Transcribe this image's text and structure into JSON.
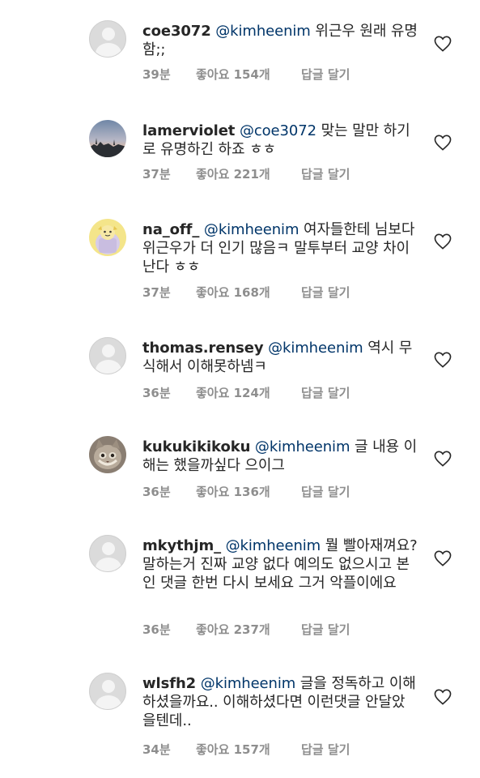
{
  "comments": [
    {
      "username": "coe3072",
      "mention": "@kimheenim",
      "text": "위근우 원래 유명함;;",
      "time": "39분",
      "likes": "좋아요 154개",
      "reply": "답글 달기",
      "avatar_icon": "default-avatar-icon"
    },
    {
      "username": "lamerviolet",
      "mention": "@coe3072",
      "text": "맞는 말만 하기로 유명하긴 하죠 ㅎㅎ",
      "time": "37분",
      "likes": "좋아요 221개",
      "reply": "답글 달기",
      "avatar_icon": "sunset-photo-avatar"
    },
    {
      "username": "na_off_",
      "mention": "@kimheenim",
      "text": "여자들한테 님보다 위근우가 더 인기 많음ㅋ 말투부터 교양 차이난다 ㅎㅎ",
      "time": "37분",
      "likes": "좋아요 168개",
      "reply": "답글 달기",
      "avatar_icon": "cartoon-character-avatar"
    },
    {
      "username": "thomas.rensey",
      "mention": "@kimheenim",
      "text": "역시 무식해서 이해못하넴ㅋ",
      "time": "36분",
      "likes": "좋아요 124개",
      "reply": "답글 달기",
      "avatar_icon": "default-avatar-icon"
    },
    {
      "username": "kukukikikoku",
      "mention": "@kimheenim",
      "text": "글 내용 이해는 했을까싶다 으이그",
      "time": "36분",
      "likes": "좋아요 136개",
      "reply": "답글 달기",
      "avatar_icon": "cat-photo-avatar"
    },
    {
      "username": "mkythjm_",
      "mention": "@kimheenim",
      "text": "뭘 빨아재껴요? 말하는거 진짜 교양 없다 예의도 없으시고 본인 댓글 한번 다시 보세요 그거 악플이에요",
      "time": "36분",
      "likes": "좋아요 237개",
      "reply": "답글 달기",
      "avatar_icon": "default-avatar-icon"
    },
    {
      "username": "wlsfh2",
      "mention": "@kimheenim",
      "text": "글을 정독하고 이해하셨을까요.. 이해하셨다면 이런댓글 안달았을텐데..",
      "time": "34분",
      "likes": "좋아요 157개",
      "reply": "답글 달기",
      "avatar_icon": "default-avatar-icon"
    }
  ],
  "colors": {
    "text": "#262626",
    "mention": "#003569",
    "meta": "#8e8e8e",
    "heart": "#262626"
  }
}
